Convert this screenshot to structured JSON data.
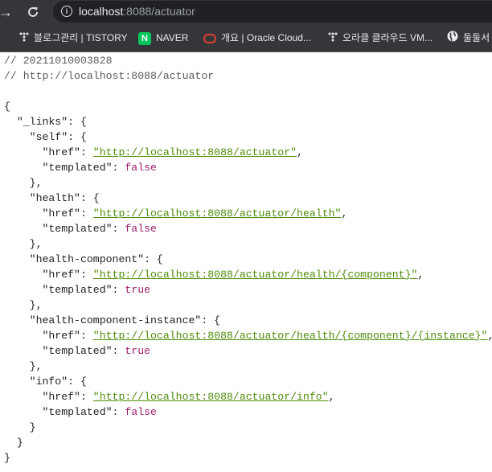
{
  "browser": {
    "url_host": "localhost",
    "url_rest": ":8088/actuator"
  },
  "bookmarks": [
    {
      "label": "블로그관리 | TISTORY"
    },
    {
      "label": "NAVER"
    },
    {
      "label": "개요 | Oracle Cloud..."
    },
    {
      "label": "오라클 클라우드 VM..."
    },
    {
      "label": "둘둘서"
    }
  ],
  "json_view": {
    "comment_timestamp": "// 20211010003828",
    "comment_url": "// http://localhost:8088/actuator",
    "root_key": "\"_links\"",
    "href_key": "\"href\"",
    "templated_key": "\"templated\"",
    "links": [
      {
        "name": "\"self\"",
        "href": "\"http://localhost:8088/actuator\"",
        "templated": "false"
      },
      {
        "name": "\"health\"",
        "href": "\"http://localhost:8088/actuator/health\"",
        "templated": "false"
      },
      {
        "name": "\"health-component\"",
        "href": "\"http://localhost:8088/actuator/health/{component}\"",
        "templated": "true"
      },
      {
        "name": "\"health-component-instance\"",
        "href": "\"http://localhost:8088/actuator/health/{component}/{instance}\"",
        "templated": "true"
      },
      {
        "name": "\"info\"",
        "href": "\"http://localhost:8088/actuator/info\"",
        "templated": "false"
      }
    ]
  }
}
